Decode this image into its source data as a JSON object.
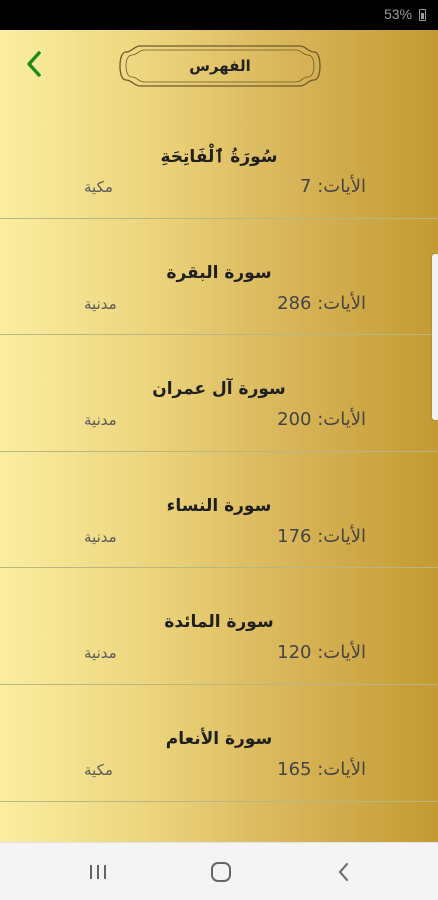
{
  "status_bar": {
    "battery": "53%"
  },
  "header": {
    "title": "الفهرس",
    "back_icon": "chevron-left-icon",
    "accent_color": "#1f8a1f"
  },
  "surahs": [
    {
      "name": "سُورَةُ ٱلْفَاتِحَةِ",
      "verses": "الأيات: 7",
      "type": "مكية"
    },
    {
      "name": "سورة البقرة",
      "verses": "الأيات: 286",
      "type": "مدنية"
    },
    {
      "name": "سورة آل عمران",
      "verses": "الأيات: 200",
      "type": "مدنية"
    },
    {
      "name": "سورة النساء",
      "verses": "الأيات: 176",
      "type": "مدنية"
    },
    {
      "name": "سورة المائدة",
      "verses": "الأيات: 120",
      "type": "مدنية"
    },
    {
      "name": "سورة الأنعام",
      "verses": "الأيات: 165",
      "type": "مكية"
    }
  ],
  "nav_bar": {
    "icons": [
      "recent-apps-icon",
      "home-icon",
      "back-icon"
    ]
  }
}
